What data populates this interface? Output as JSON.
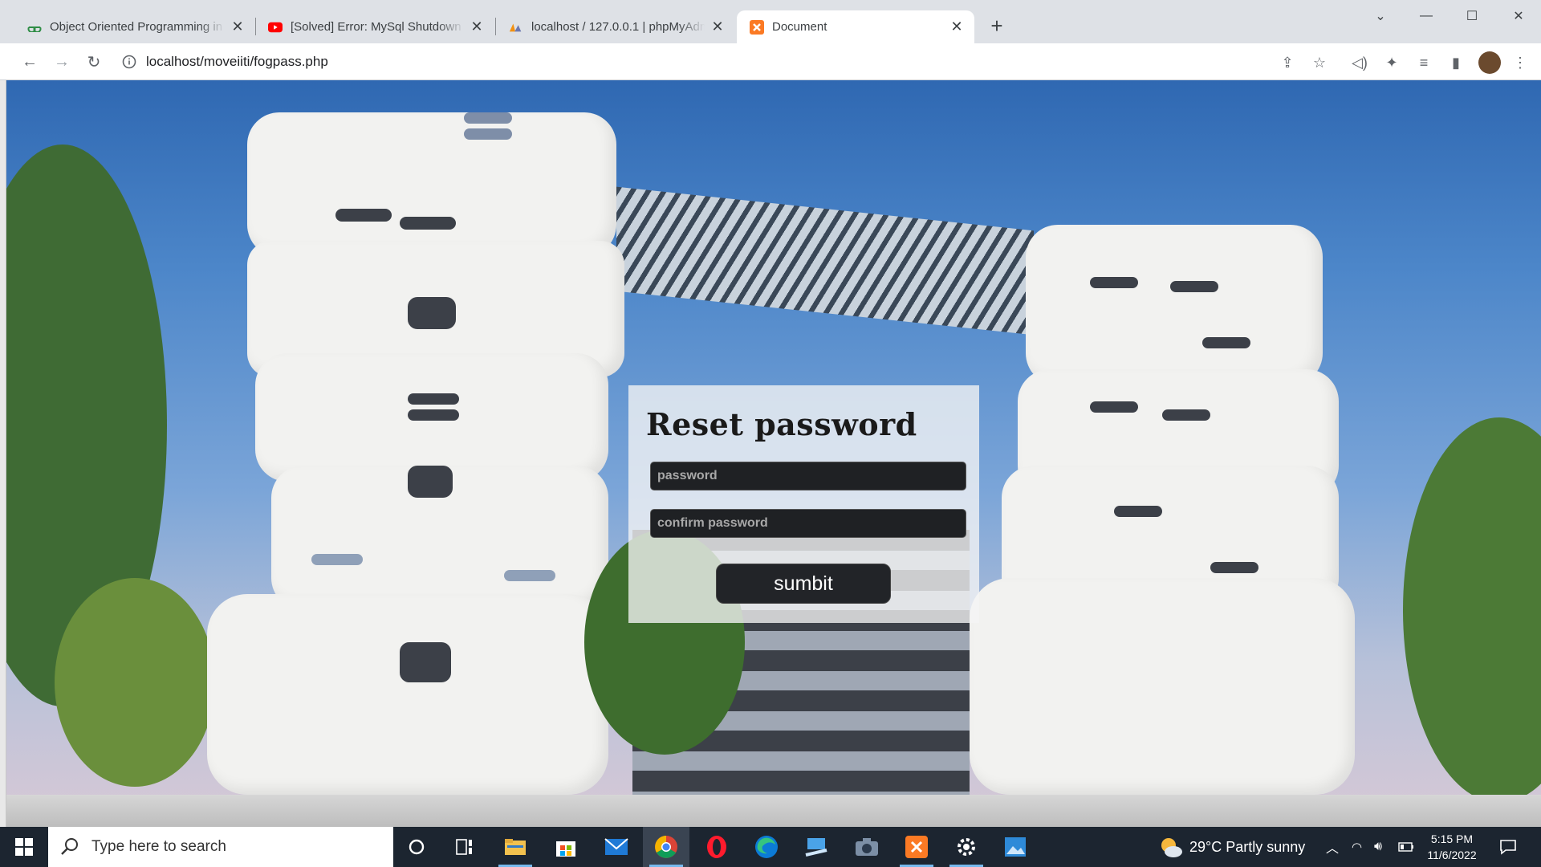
{
  "browser": {
    "tabs": [
      {
        "title": "Object Oriented Programming in",
        "icon": "gfg-icon",
        "color": "#2f8d46"
      },
      {
        "title": "[Solved] Error: MySql Shutdown U",
        "icon": "youtube-icon",
        "color": "#ff0000"
      },
      {
        "title": "localhost / 127.0.0.1 | phpMyAdm",
        "icon": "phpmyadmin-icon",
        "color": "#f29111"
      },
      {
        "title": "Document",
        "icon": "xampp-icon",
        "color": "#fb7a24"
      }
    ],
    "new_tab": "+",
    "url": "localhost/moveiiti/fogpass.php"
  },
  "page": {
    "heading": "Reset password",
    "password_placeholder": "password",
    "confirm_placeholder": "confirm password",
    "submit_label": "sumbit"
  },
  "taskbar": {
    "search_placeholder": "Type here to search",
    "weather": "29°C  Partly sunny",
    "time": "5:15 PM",
    "date": "11/6/2022"
  }
}
